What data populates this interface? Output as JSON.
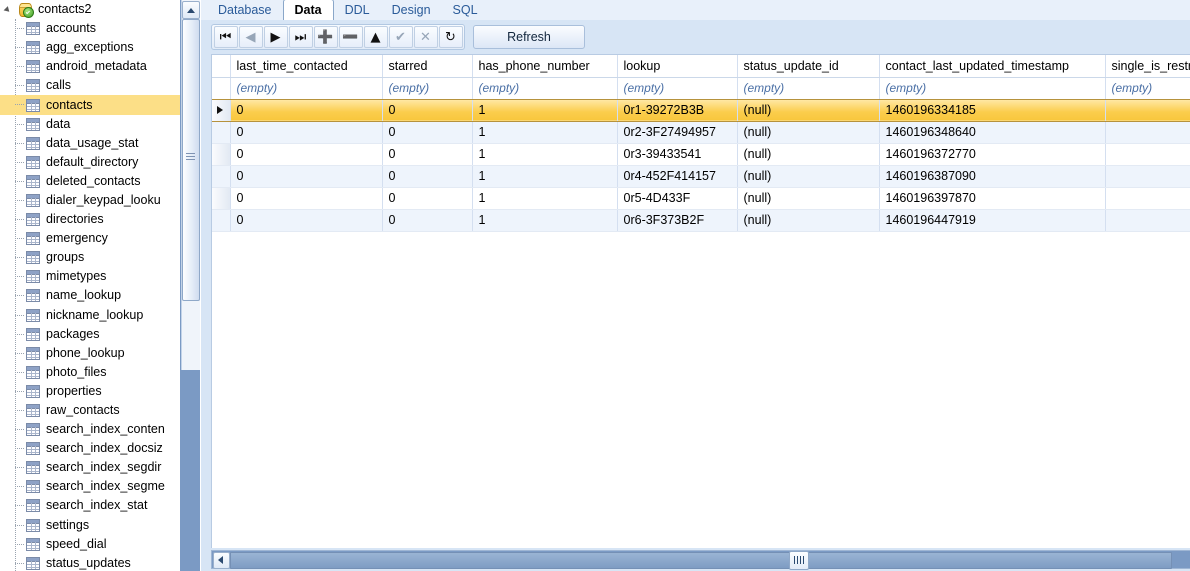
{
  "sidebar": {
    "root": {
      "label": "contacts2",
      "icon": "database-icon",
      "expanded": true
    },
    "tables": [
      "accounts",
      "agg_exceptions",
      "android_metadata",
      "calls",
      "contacts",
      "data",
      "data_usage_stat",
      "default_directory",
      "deleted_contacts",
      "dialer_keypad_looku",
      "directories",
      "emergency",
      "groups",
      "mimetypes",
      "name_lookup",
      "nickname_lookup",
      "packages",
      "phone_lookup",
      "photo_files",
      "properties",
      "raw_contacts",
      "search_index_conten",
      "search_index_docsiz",
      "search_index_segdir",
      "search_index_segme",
      "search_index_stat",
      "settings",
      "speed_dial",
      "status_updates"
    ],
    "selected": "contacts"
  },
  "tabs": [
    {
      "label": "Database",
      "active": false
    },
    {
      "label": "Data",
      "active": true
    },
    {
      "label": "DDL",
      "active": false
    },
    {
      "label": "Design",
      "active": false
    },
    {
      "label": "SQL",
      "active": false
    }
  ],
  "toolbar": {
    "buttons": [
      {
        "name": "first-record-button",
        "glyph": "⏮",
        "enabled": true
      },
      {
        "name": "previous-record-button",
        "glyph": "◀",
        "enabled": false
      },
      {
        "name": "next-record-button",
        "glyph": "▶",
        "enabled": true
      },
      {
        "name": "last-record-button",
        "glyph": "⏭",
        "enabled": true
      },
      {
        "name": "insert-record-button",
        "glyph": "➕",
        "enabled": true
      },
      {
        "name": "delete-record-button",
        "glyph": "➖",
        "enabled": true
      },
      {
        "name": "edit-record-button",
        "glyph": "▲",
        "enabled": true
      },
      {
        "name": "commit-button",
        "glyph": "✔",
        "enabled": false
      },
      {
        "name": "cancel-button",
        "glyph": "✕",
        "enabled": false
      },
      {
        "name": "revert-button",
        "glyph": "↻",
        "enabled": true
      }
    ],
    "refresh_label": "Refresh"
  },
  "grid": {
    "columns": [
      "last_time_contacted",
      "starred",
      "has_phone_number",
      "lookup",
      "status_update_id",
      "contact_last_updated_timestamp",
      "single_is_restr"
    ],
    "filter_placeholder": "(empty)",
    "filters": [
      "(empty)",
      "(empty)",
      "(empty)",
      "(empty)",
      "(empty)",
      "(empty)",
      "(empty)"
    ],
    "rows": [
      {
        "cells": [
          "0",
          "0",
          "1",
          "0r1-39272B3B",
          "(null)",
          "1460196334185",
          ""
        ],
        "selected": true
      },
      {
        "cells": [
          "0",
          "0",
          "1",
          "0r2-3F27494957",
          "(null)",
          "1460196348640",
          ""
        ],
        "selected": false
      },
      {
        "cells": [
          "0",
          "0",
          "1",
          "0r3-39433541",
          "(null)",
          "1460196372770",
          ""
        ],
        "selected": false
      },
      {
        "cells": [
          "0",
          "0",
          "1",
          "0r4-452F414157",
          "(null)",
          "1460196387090",
          ""
        ],
        "selected": false
      },
      {
        "cells": [
          "0",
          "0",
          "1",
          "0r5-4D433F",
          "(null)",
          "1460196397870",
          ""
        ],
        "selected": false
      },
      {
        "cells": [
          "0",
          "0",
          "1",
          "0r6-3F373B2F",
          "(null)",
          "1460196447919",
          ""
        ],
        "selected": false
      }
    ]
  },
  "colors": {
    "selection_yellow": "#fbcd4c",
    "tree_selection": "#fcdf87",
    "panel_blue": "#d7e5f5",
    "scrollbar_blue": "#7b9ac4",
    "alt_row": "#eef4fc"
  }
}
